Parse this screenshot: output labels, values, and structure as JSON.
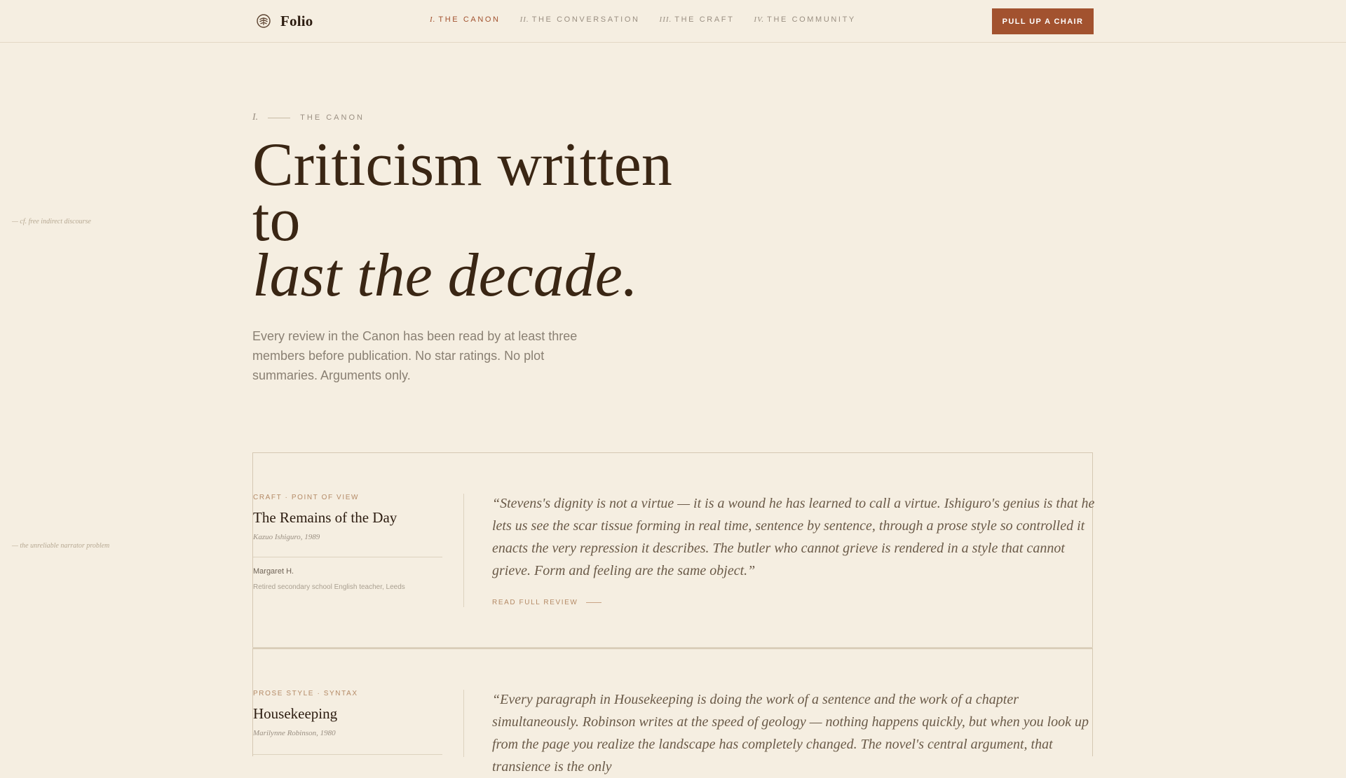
{
  "header": {
    "brand": "Folio",
    "nav": [
      {
        "num": "I.",
        "label": "THE CANON",
        "active": true
      },
      {
        "num": "II.",
        "label": "THE CONVERSATION",
        "active": false
      },
      {
        "num": "III.",
        "label": "THE CRAFT",
        "active": false
      },
      {
        "num": "IV.",
        "label": "THE COMMUNITY",
        "active": false
      }
    ],
    "cta_label": "PULL UP A CHAIR"
  },
  "marginalia": [
    "— cf. free indirect discourse",
    "— the unreliable narrator problem"
  ],
  "hero": {
    "kicker_num": "I.",
    "kicker_label": "THE CANON",
    "title_line1": "Criticism written",
    "title_line2": "to",
    "title_line3": "last the decade.",
    "subtitle": "Every review in the Canon has been read by at least three members before publication. No star ratings. No plot summaries. Arguments only."
  },
  "reviews": [
    {
      "tag": "CRAFT · POINT OF VIEW",
      "title": "The Remains of the Day",
      "book": "Kazuo Ishiguro, 1989",
      "reviewer": "Margaret H.",
      "reviewer_bio": "Retired secondary school English teacher, Leeds",
      "quote": "“Stevens's dignity is not a virtue — it is a wound he has learned to call a virtue. Ishiguro's genius is that he lets us see the scar tissue forming in real time, sentence by sentence, through a prose style so controlled it enacts the very repression it describes. The butler who cannot grieve is rendered in a style that cannot grieve. Form and feeling are the same object.”",
      "link_label": "READ FULL REVIEW"
    },
    {
      "tag": "PROSE STYLE · SYNTAX",
      "title": "Housekeeping",
      "book": "Marilynne Robinson, 1980",
      "quote": "“Every paragraph in Housekeeping is doing the work of a sentence and the work of a chapter simultaneously. Robinson writes at the speed of geology — nothing happens quickly, but when you look up from the page you realize the landscape has completely changed. The novel's central argument, that transience is the only"
    }
  ],
  "colors": {
    "background": "#f5eee1",
    "accent": "#a2522f",
    "heading": "#3a2614"
  },
  "icons": {
    "brand": "folio-emblem-icon"
  }
}
